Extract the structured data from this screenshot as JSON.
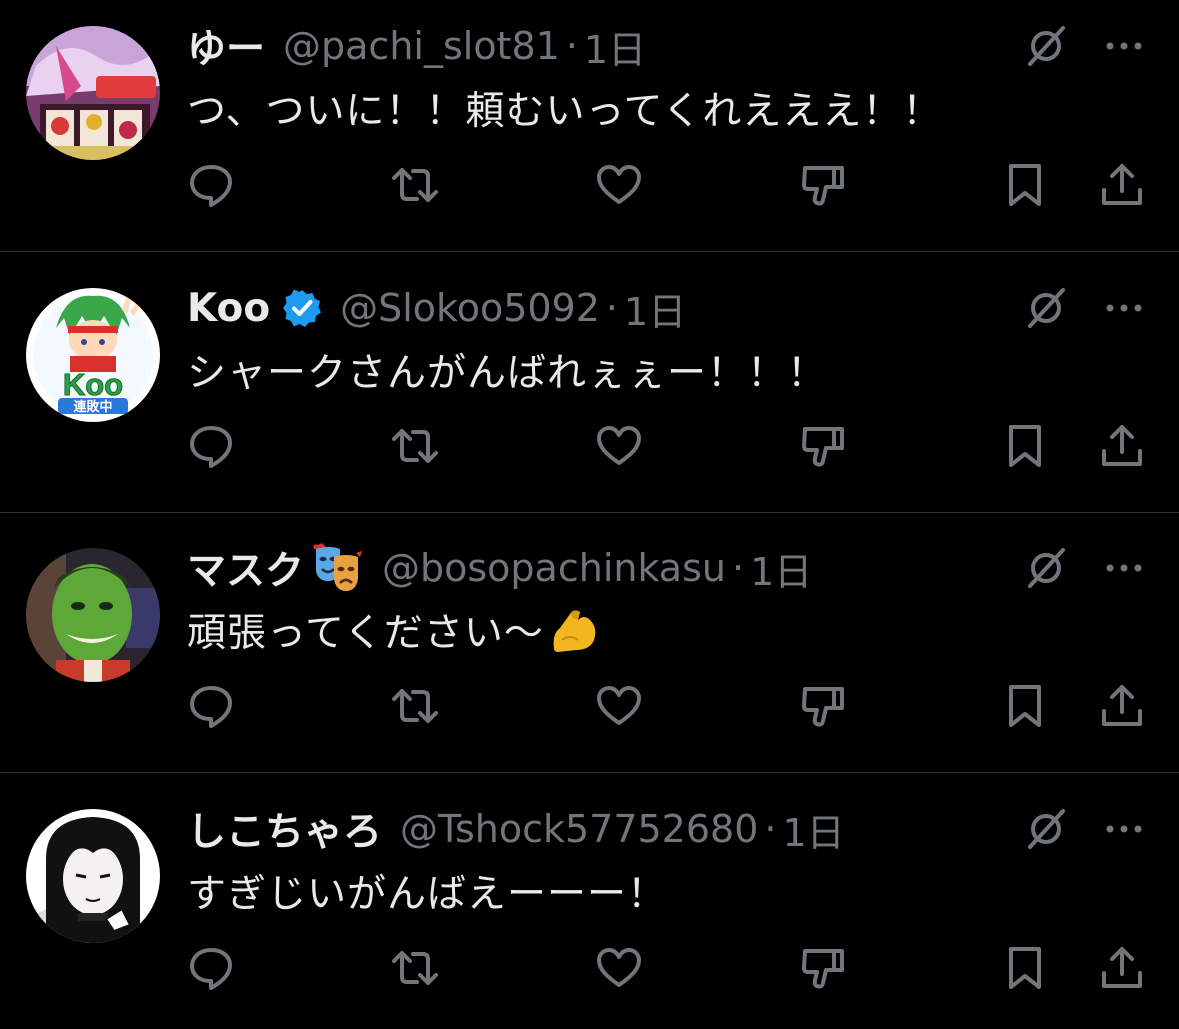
{
  "colors": {
    "background": "#000000",
    "text": "#e7e9ea",
    "secondary": "#71767b",
    "divider": "#2f3336",
    "verified": "#1d9bf0"
  },
  "icons": {
    "header": [
      "grok-icon",
      "more-icon"
    ],
    "actions": [
      "reply-icon",
      "retweet-icon",
      "like-icon",
      "dislike-icon",
      "bookmark-icon",
      "share-icon"
    ]
  },
  "replies": [
    {
      "name": "ゆー",
      "handle": "@pachi_slot81",
      "separator": "·",
      "time": "1日",
      "text": "つ、ついに！！頼むいってくれえええ！！",
      "avatar": "pachislot-machine-avatar"
    },
    {
      "name": "Koo",
      "verified": true,
      "handle": "@Slokoo5092",
      "separator": "·",
      "time": "1日",
      "text": "シャークさんがんばれぇぇー！！！",
      "avatar": "koo-logo-avatar",
      "avatar_text": "Koo",
      "avatar_subtext": "連敗中"
    },
    {
      "name": "マスク",
      "name_emoji": "performing-arts-emoji",
      "handle": "@bosopachinkasu",
      "separator": "·",
      "time": "1日",
      "text": "頑張ってください〜",
      "text_emoji": "flexed-biceps-emoji",
      "avatar": "green-mask-face-avatar"
    },
    {
      "name": "しこちゃろ",
      "handle": "@Tshock57752680",
      "separator": "·",
      "time": "1日",
      "text": "すぎじいがんばえーーー！",
      "avatar": "manga-character-avatar"
    }
  ]
}
